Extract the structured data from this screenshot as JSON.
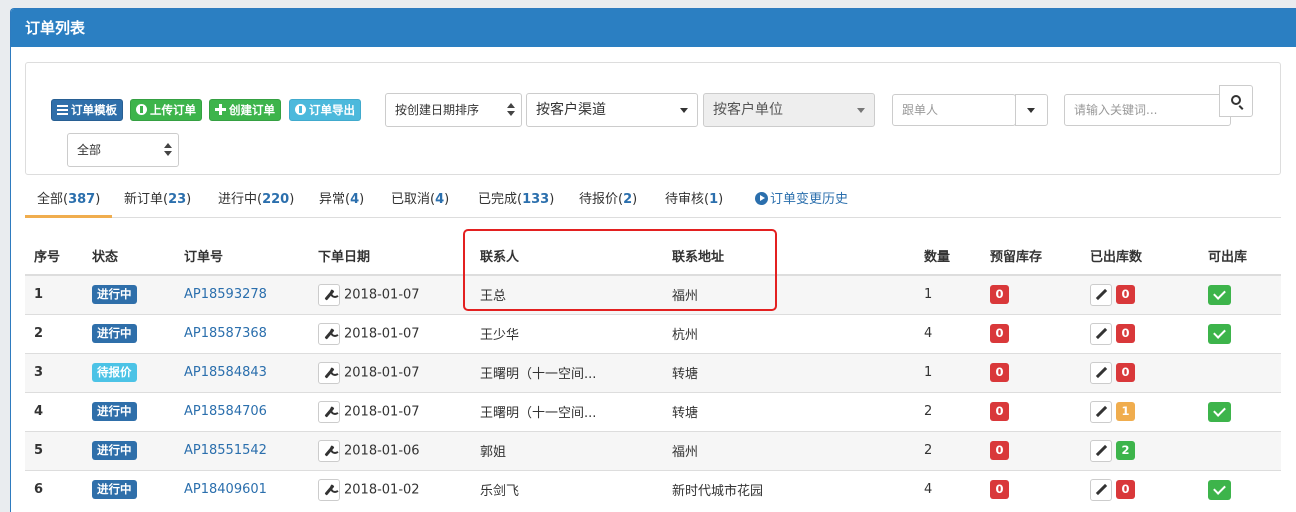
{
  "header": {
    "title": "订单列表"
  },
  "toolbar": {
    "template_label": "订单模板",
    "upload_label": "上传订单",
    "create_label": "创建订单",
    "export_label": "订单导出"
  },
  "filters": {
    "sort_value": "按创建日期排序",
    "channel_value": "按客户渠道",
    "unit_value": "按客户单位",
    "follower_placeholder": "跟单人",
    "keyword_placeholder": "请输入关键词...",
    "scope_value": "全部"
  },
  "tabs": [
    {
      "label": "全部(",
      "count": "387",
      "close": ")"
    },
    {
      "label": "新订单(",
      "count": "23",
      "close": ")"
    },
    {
      "label": "进行中(",
      "count": "220",
      "close": ")"
    },
    {
      "label": "异常(",
      "count": "4",
      "close": ")"
    },
    {
      "label": "已取消(",
      "count": "4",
      "close": ")"
    },
    {
      "label": "已完成(",
      "count": "133",
      "close": ")"
    },
    {
      "label": "待报价(",
      "count": "2",
      "close": ")"
    },
    {
      "label": "待审核(",
      "count": "1",
      "close": ")"
    }
  ],
  "history_label": "订单变更历史",
  "columns": [
    "序号",
    "状态",
    "订单号",
    "下单日期",
    "联系人",
    "联系地址",
    "数量",
    "预留库存",
    "已出库数",
    "可出库"
  ],
  "rows": [
    {
      "no": "1",
      "status": "进行中",
      "order": "AP18593278",
      "date": "2018-01-07",
      "contact": "王总",
      "address": "福州",
      "qty": "1",
      "reserved": "0",
      "shipped": "0",
      "can_ship": true
    },
    {
      "no": "2",
      "status": "进行中",
      "order": "AP18587368",
      "date": "2018-01-07",
      "contact": "王少华",
      "address": "杭州",
      "qty": "4",
      "reserved": "0",
      "shipped": "0",
      "can_ship": true
    },
    {
      "no": "3",
      "status": "待报价",
      "order": "AP18584843",
      "date": "2018-01-07",
      "contact": "王曙明（十一空间...",
      "address": "转塘",
      "qty": "1",
      "reserved": "0",
      "shipped": "0",
      "can_ship": false
    },
    {
      "no": "4",
      "status": "进行中",
      "order": "AP18584706",
      "date": "2018-01-07",
      "contact": "王曙明（十一空间...",
      "address": "转塘",
      "qty": "2",
      "reserved": "0",
      "shipped": "1",
      "can_ship": true
    },
    {
      "no": "5",
      "status": "进行中",
      "order": "AP18551542",
      "date": "2018-01-06",
      "contact": "郭姐",
      "address": "福州",
      "qty": "2",
      "reserved": "0",
      "shipped": "2",
      "can_ship": false
    },
    {
      "no": "6",
      "status": "进行中",
      "order": "AP18409601",
      "date": "2018-01-02",
      "contact": "乐剑飞",
      "address": "新时代城市花园",
      "qty": "4",
      "reserved": "0",
      "shipped": "0",
      "can_ship": true
    }
  ],
  "colors": {
    "header": "#2b7fc2",
    "link": "#2b6fad",
    "red": "#d9383a",
    "green": "#3db44b",
    "orange": "#f0ad4e",
    "highlight": "#e32020"
  }
}
